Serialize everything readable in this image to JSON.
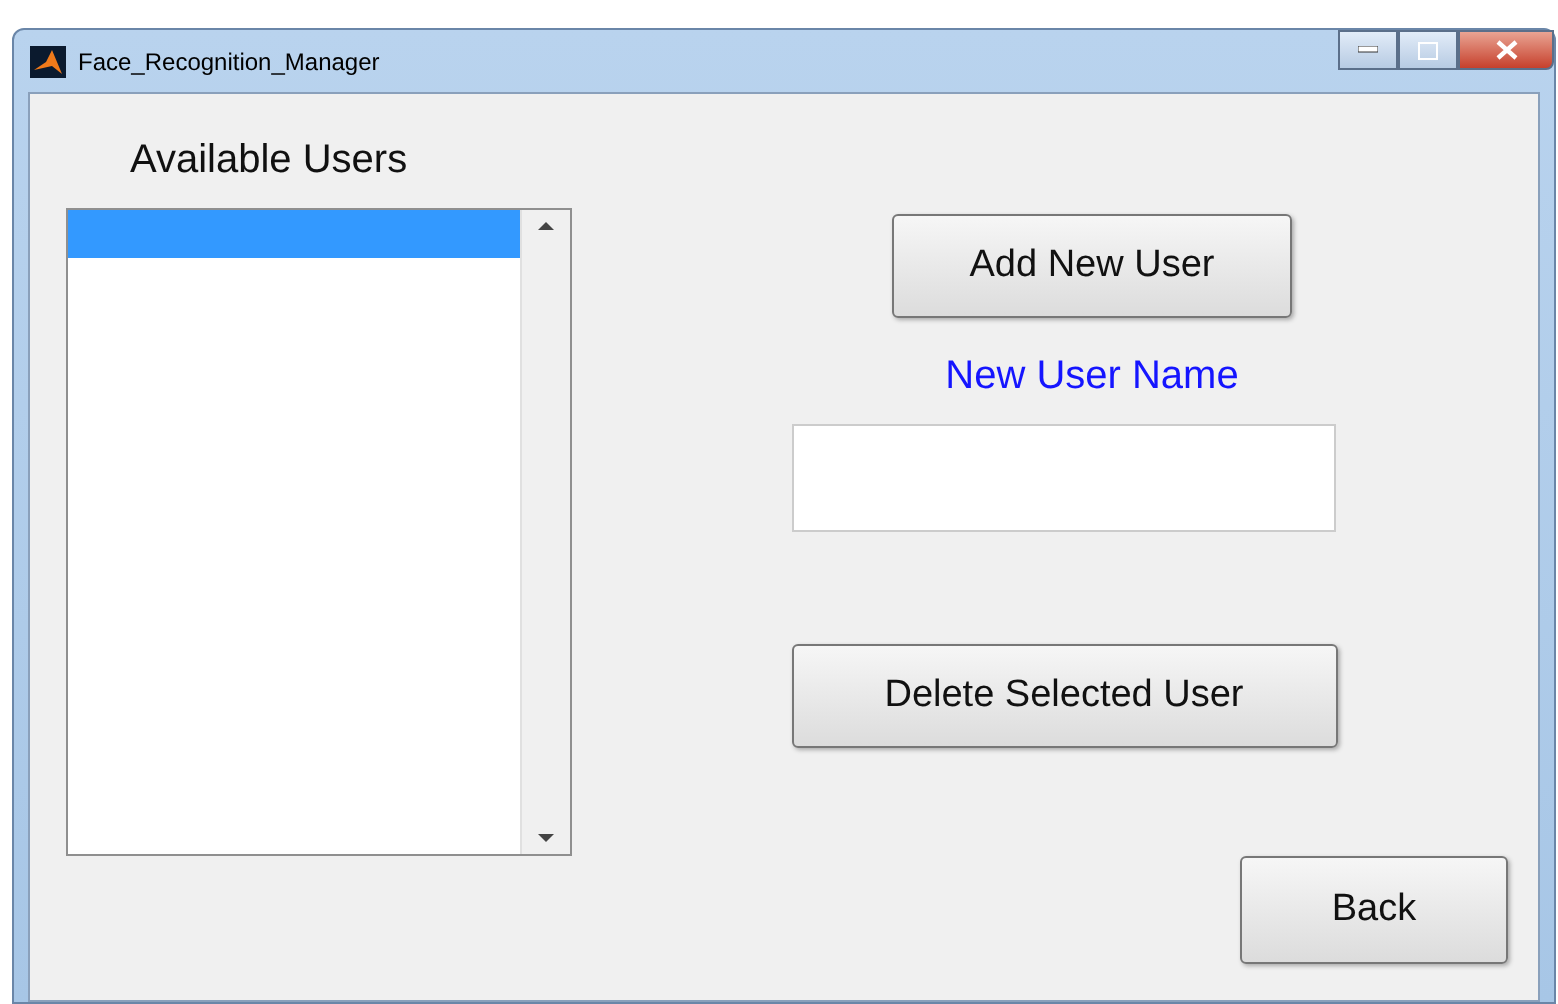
{
  "window": {
    "title": "Face_Recognition_Manager"
  },
  "users_label": "Available Users",
  "users_list": {
    "rows": [
      {
        "selected": true
      }
    ]
  },
  "add_button": "Add New User",
  "name_label": "New User Name",
  "delete_button": "Delete Selected User",
  "back_button": "Back"
}
